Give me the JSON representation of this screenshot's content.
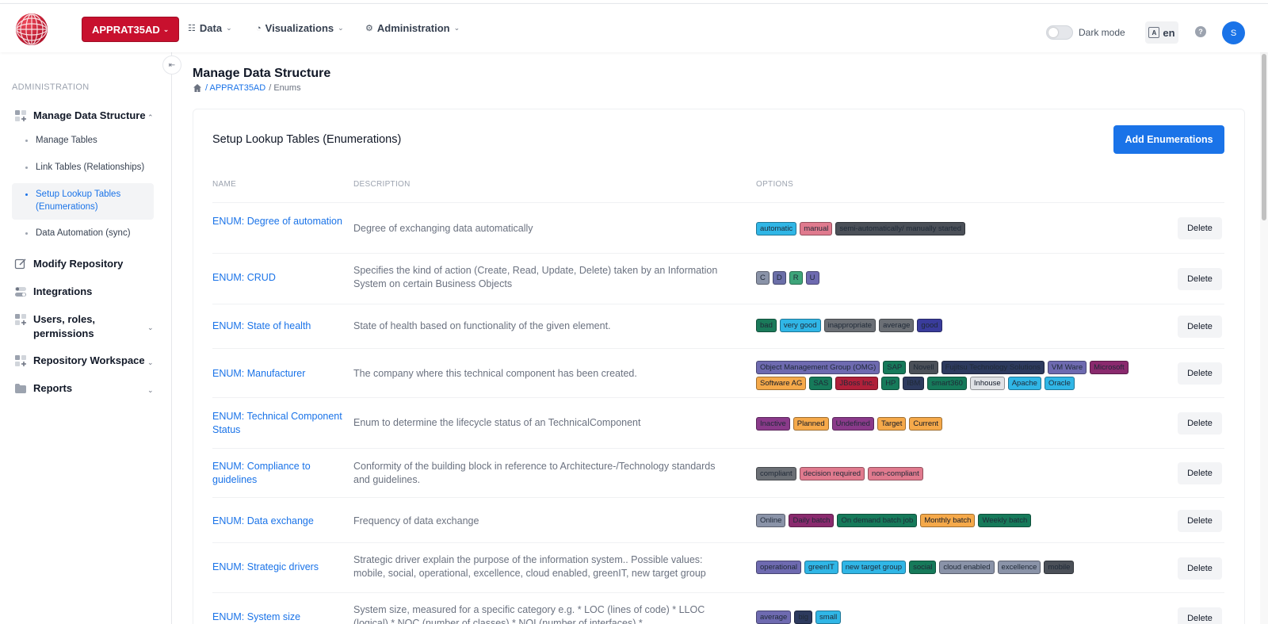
{
  "header": {
    "workspace": "APPRAT35AD",
    "nav": [
      {
        "label": "Data",
        "icon": "sitemap-icon"
      },
      {
        "label": "Visualizations",
        "icon": "pie-chart-icon"
      },
      {
        "label": "Administration",
        "icon": "cogs-icon"
      }
    ],
    "dark_mode_label": "Dark mode",
    "language": "en",
    "help": "?",
    "avatar_initial": "S"
  },
  "sidebar": {
    "heading": "ADMINISTRATION",
    "sections": [
      {
        "label": "Manage Data Structure",
        "icon": "grid-plus-icon",
        "expanded": true
      },
      {
        "label": "Modify Repository",
        "icon": "edit-icon"
      },
      {
        "label": "Integrations",
        "icon": "toggle-icon"
      },
      {
        "label": "Users, roles, permissions",
        "icon": "grid-plus-icon"
      },
      {
        "label": "Repository Workspace",
        "icon": "grid-plus-icon"
      },
      {
        "label": "Reports",
        "icon": "folder-icon"
      }
    ],
    "sub_items": [
      {
        "label": "Manage Tables"
      },
      {
        "label": "Link Tables (Relationships)"
      },
      {
        "label": "Setup Lookup Tables (Enumerations)",
        "active": true
      },
      {
        "label": "Data Automation (sync)"
      }
    ]
  },
  "page": {
    "title": "Manage Data Structure",
    "breadcrumb": [
      "/ APPRAT35AD",
      "/ Enums"
    ]
  },
  "card": {
    "title": "Setup Lookup Tables (Enumerations)",
    "add_button": "Add Enumerations",
    "columns": [
      "NAME",
      "DESCRIPTION",
      "OPTIONS"
    ],
    "delete_label": "Delete",
    "rows": [
      {
        "name": "ENUM: Degree of automation",
        "description": "Degree of exchanging data automatically",
        "options": [
          {
            "label": "automatic",
            "color": "#30b6e6"
          },
          {
            "label": "manual",
            "color": "#e07a8e"
          },
          {
            "label": "semi-automatically/ manually started",
            "color": "#4b5058"
          }
        ]
      },
      {
        "name": "ENUM: CRUD",
        "description": "Specifies the kind of action (Create, Read, Update, Delete) taken by an Information System on certain Business Objects",
        "options": [
          {
            "label": "C",
            "color": "#8a93a8"
          },
          {
            "label": "D",
            "color": "#6b6fa8"
          },
          {
            "label": "R",
            "color": "#3ea57a"
          },
          {
            "label": "U",
            "color": "#6e6ab0"
          }
        ]
      },
      {
        "name": "ENUM: State of health",
        "description": "State of health based on functionality of the given element.",
        "options": [
          {
            "label": "bad",
            "color": "#1a7a5a"
          },
          {
            "label": "very good",
            "color": "#30b6e6"
          },
          {
            "label": "inappropriate",
            "color": "#6b6f75"
          },
          {
            "label": "average",
            "color": "#6b6f75"
          },
          {
            "label": "good",
            "color": "#3a3c9c"
          }
        ]
      },
      {
        "name": "ENUM: Manufacturer",
        "description": "The company where this technical component has been created.",
        "options": [
          {
            "label": "Object Management Group (OMG)",
            "color": "#6e6ab0"
          },
          {
            "label": "SAP",
            "color": "#167a5a"
          },
          {
            "label": "Novell",
            "color": "#4b5058"
          },
          {
            "label": "Fujitsu Technology Solutions",
            "color": "#2d3a5e"
          },
          {
            "label": "VM Ware",
            "color": "#6e6ab0"
          },
          {
            "label": "Microsoft",
            "color": "#8a2a6e"
          },
          {
            "label": "Software AG",
            "color": "#f5a94a"
          },
          {
            "label": "SAS",
            "color": "#167a5a"
          },
          {
            "label": "JBoss Inc.",
            "color": "#b0203a"
          },
          {
            "label": "HP",
            "color": "#167a5a"
          },
          {
            "label": "IBM",
            "color": "#2d3a5e"
          },
          {
            "label": "smart360",
            "color": "#167a5a"
          },
          {
            "label": "Inhouse",
            "color": "#e0e2e6"
          },
          {
            "label": "Apache",
            "color": "#30b6e6"
          },
          {
            "label": "Oracle",
            "color": "#30b6e6"
          }
        ]
      },
      {
        "name": "ENUM: Technical Component Status",
        "description": "Enum to determine the lifecycle status of an TechnicalComponent",
        "options": [
          {
            "label": "Inactive",
            "color": "#8a3a8a"
          },
          {
            "label": "Planned",
            "color": "#f5a94a"
          },
          {
            "label": "Undefined",
            "color": "#8a3a8a"
          },
          {
            "label": "Target",
            "color": "#f5a94a"
          },
          {
            "label": "Current",
            "color": "#f5a94a"
          }
        ]
      },
      {
        "name": "ENUM: Compliance to guidelines",
        "description": "Conformity of the building block in reference to Architecture-/Technology standards and guidelines.",
        "options": [
          {
            "label": "compliant",
            "color": "#6b6f75"
          },
          {
            "label": "decision required",
            "color": "#e07a8e"
          },
          {
            "label": "non-compliant",
            "color": "#e07a8e"
          }
        ]
      },
      {
        "name": "ENUM: Data exchange",
        "description": "Frequency of data exchange",
        "options": [
          {
            "label": "Online",
            "color": "#8a93a8"
          },
          {
            "label": "Daily batch",
            "color": "#8a2a6e"
          },
          {
            "label": "On demand batch job",
            "color": "#167a5a"
          },
          {
            "label": "Monthly batch",
            "color": "#f5a94a"
          },
          {
            "label": "Weekly batch",
            "color": "#167a5a"
          }
        ]
      },
      {
        "name": "ENUM: Strategic drivers",
        "description": "Strategic driver explain the purpose of the information system.. Possible values: mobile, social, operational, excellence, cloud enabled, greenIT, new target group",
        "options": [
          {
            "label": "operational",
            "color": "#6e6ab0"
          },
          {
            "label": "greenIT",
            "color": "#30b6e6"
          },
          {
            "label": "new target group",
            "color": "#30b6e6"
          },
          {
            "label": "social",
            "color": "#167a5a"
          },
          {
            "label": "cloud enabled",
            "color": "#8a93a8"
          },
          {
            "label": "excellence",
            "color": "#8a93a8"
          },
          {
            "label": "mobile",
            "color": "#4b5058"
          }
        ]
      },
      {
        "name": "ENUM: System size",
        "description": "System size, measured for a specific category e.g. * LOC (lines of code) * LLOC (logical) * NOC (number of classes) * NOI (number of interfaces) *",
        "options": [
          {
            "label": "average",
            "color": "#6e6ab0"
          },
          {
            "label": "big",
            "color": "#2d3a5e"
          },
          {
            "label": "small",
            "color": "#30b6e6"
          }
        ]
      }
    ]
  }
}
